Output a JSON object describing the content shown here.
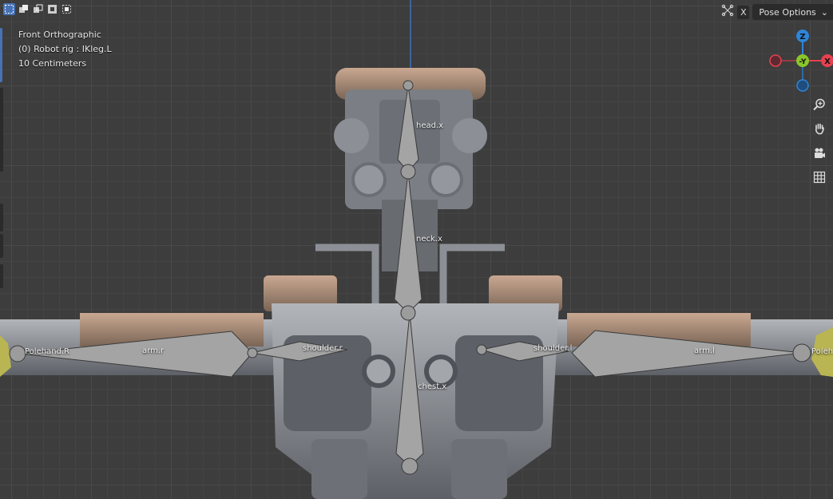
{
  "toolbar": {
    "select_modes": [
      "select-box-icon",
      "extend-icon",
      "subtract-icon",
      "invert-icon",
      "intersect-icon"
    ]
  },
  "viewport_info": {
    "view_name": "Front Orthographic",
    "object_info": "(0) Robot rig : IKleg.L",
    "scale": "10 Centimeters"
  },
  "header": {
    "x_toggle": "X",
    "pose_options": "Pose Options",
    "pose_options_chevron": "⌄"
  },
  "gizmo": {
    "z_label": "Z",
    "y_label": "-Y",
    "x_label": "X",
    "colors": {
      "x": "#e7414f",
      "y": "#8ac62a",
      "z": "#2e85d9"
    }
  },
  "bones": {
    "head": "head.x",
    "neck": "neck.x",
    "chest": "chest.x",
    "shoulder_r": "shoulder.r",
    "shoulder_l": "shoulder.l",
    "arm_r": "arm.r",
    "arm_l": "arm.l",
    "polehand_r": "Polehand.R",
    "polehand_l": "Poleh"
  }
}
